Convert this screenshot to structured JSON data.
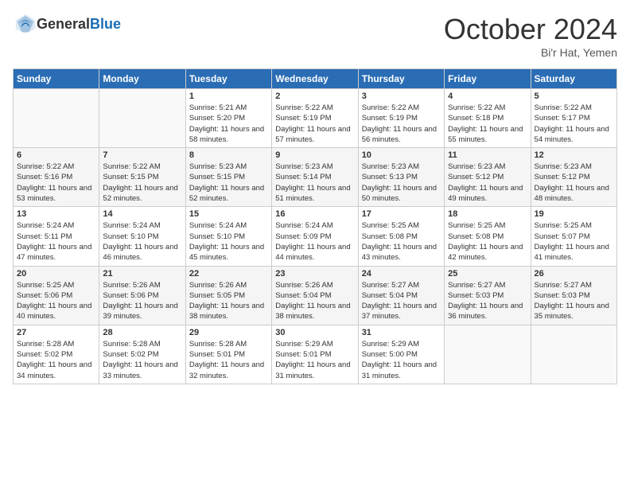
{
  "logo": {
    "general": "General",
    "blue": "Blue"
  },
  "header": {
    "month": "October 2024",
    "location": "Bi'r Hat, Yemen"
  },
  "days_of_week": [
    "Sunday",
    "Monday",
    "Tuesday",
    "Wednesday",
    "Thursday",
    "Friday",
    "Saturday"
  ],
  "weeks": [
    [
      {
        "day": "",
        "sunrise": "",
        "sunset": "",
        "daylight": ""
      },
      {
        "day": "",
        "sunrise": "",
        "sunset": "",
        "daylight": ""
      },
      {
        "day": "1",
        "sunrise": "Sunrise: 5:21 AM",
        "sunset": "Sunset: 5:20 PM",
        "daylight": "Daylight: 11 hours and 58 minutes."
      },
      {
        "day": "2",
        "sunrise": "Sunrise: 5:22 AM",
        "sunset": "Sunset: 5:19 PM",
        "daylight": "Daylight: 11 hours and 57 minutes."
      },
      {
        "day": "3",
        "sunrise": "Sunrise: 5:22 AM",
        "sunset": "Sunset: 5:19 PM",
        "daylight": "Daylight: 11 hours and 56 minutes."
      },
      {
        "day": "4",
        "sunrise": "Sunrise: 5:22 AM",
        "sunset": "Sunset: 5:18 PM",
        "daylight": "Daylight: 11 hours and 55 minutes."
      },
      {
        "day": "5",
        "sunrise": "Sunrise: 5:22 AM",
        "sunset": "Sunset: 5:17 PM",
        "daylight": "Daylight: 11 hours and 54 minutes."
      }
    ],
    [
      {
        "day": "6",
        "sunrise": "Sunrise: 5:22 AM",
        "sunset": "Sunset: 5:16 PM",
        "daylight": "Daylight: 11 hours and 53 minutes."
      },
      {
        "day": "7",
        "sunrise": "Sunrise: 5:22 AM",
        "sunset": "Sunset: 5:15 PM",
        "daylight": "Daylight: 11 hours and 52 minutes."
      },
      {
        "day": "8",
        "sunrise": "Sunrise: 5:23 AM",
        "sunset": "Sunset: 5:15 PM",
        "daylight": "Daylight: 11 hours and 52 minutes."
      },
      {
        "day": "9",
        "sunrise": "Sunrise: 5:23 AM",
        "sunset": "Sunset: 5:14 PM",
        "daylight": "Daylight: 11 hours and 51 minutes."
      },
      {
        "day": "10",
        "sunrise": "Sunrise: 5:23 AM",
        "sunset": "Sunset: 5:13 PM",
        "daylight": "Daylight: 11 hours and 50 minutes."
      },
      {
        "day": "11",
        "sunrise": "Sunrise: 5:23 AM",
        "sunset": "Sunset: 5:12 PM",
        "daylight": "Daylight: 11 hours and 49 minutes."
      },
      {
        "day": "12",
        "sunrise": "Sunrise: 5:23 AM",
        "sunset": "Sunset: 5:12 PM",
        "daylight": "Daylight: 11 hours and 48 minutes."
      }
    ],
    [
      {
        "day": "13",
        "sunrise": "Sunrise: 5:24 AM",
        "sunset": "Sunset: 5:11 PM",
        "daylight": "Daylight: 11 hours and 47 minutes."
      },
      {
        "day": "14",
        "sunrise": "Sunrise: 5:24 AM",
        "sunset": "Sunset: 5:10 PM",
        "daylight": "Daylight: 11 hours and 46 minutes."
      },
      {
        "day": "15",
        "sunrise": "Sunrise: 5:24 AM",
        "sunset": "Sunset: 5:10 PM",
        "daylight": "Daylight: 11 hours and 45 minutes."
      },
      {
        "day": "16",
        "sunrise": "Sunrise: 5:24 AM",
        "sunset": "Sunset: 5:09 PM",
        "daylight": "Daylight: 11 hours and 44 minutes."
      },
      {
        "day": "17",
        "sunrise": "Sunrise: 5:25 AM",
        "sunset": "Sunset: 5:08 PM",
        "daylight": "Daylight: 11 hours and 43 minutes."
      },
      {
        "day": "18",
        "sunrise": "Sunrise: 5:25 AM",
        "sunset": "Sunset: 5:08 PM",
        "daylight": "Daylight: 11 hours and 42 minutes."
      },
      {
        "day": "19",
        "sunrise": "Sunrise: 5:25 AM",
        "sunset": "Sunset: 5:07 PM",
        "daylight": "Daylight: 11 hours and 41 minutes."
      }
    ],
    [
      {
        "day": "20",
        "sunrise": "Sunrise: 5:25 AM",
        "sunset": "Sunset: 5:06 PM",
        "daylight": "Daylight: 11 hours and 40 minutes."
      },
      {
        "day": "21",
        "sunrise": "Sunrise: 5:26 AM",
        "sunset": "Sunset: 5:06 PM",
        "daylight": "Daylight: 11 hours and 39 minutes."
      },
      {
        "day": "22",
        "sunrise": "Sunrise: 5:26 AM",
        "sunset": "Sunset: 5:05 PM",
        "daylight": "Daylight: 11 hours and 38 minutes."
      },
      {
        "day": "23",
        "sunrise": "Sunrise: 5:26 AM",
        "sunset": "Sunset: 5:04 PM",
        "daylight": "Daylight: 11 hours and 38 minutes."
      },
      {
        "day": "24",
        "sunrise": "Sunrise: 5:27 AM",
        "sunset": "Sunset: 5:04 PM",
        "daylight": "Daylight: 11 hours and 37 minutes."
      },
      {
        "day": "25",
        "sunrise": "Sunrise: 5:27 AM",
        "sunset": "Sunset: 5:03 PM",
        "daylight": "Daylight: 11 hours and 36 minutes."
      },
      {
        "day": "26",
        "sunrise": "Sunrise: 5:27 AM",
        "sunset": "Sunset: 5:03 PM",
        "daylight": "Daylight: 11 hours and 35 minutes."
      }
    ],
    [
      {
        "day": "27",
        "sunrise": "Sunrise: 5:28 AM",
        "sunset": "Sunset: 5:02 PM",
        "daylight": "Daylight: 11 hours and 34 minutes."
      },
      {
        "day": "28",
        "sunrise": "Sunrise: 5:28 AM",
        "sunset": "Sunset: 5:02 PM",
        "daylight": "Daylight: 11 hours and 33 minutes."
      },
      {
        "day": "29",
        "sunrise": "Sunrise: 5:28 AM",
        "sunset": "Sunset: 5:01 PM",
        "daylight": "Daylight: 11 hours and 32 minutes."
      },
      {
        "day": "30",
        "sunrise": "Sunrise: 5:29 AM",
        "sunset": "Sunset: 5:01 PM",
        "daylight": "Daylight: 11 hours and 31 minutes."
      },
      {
        "day": "31",
        "sunrise": "Sunrise: 5:29 AM",
        "sunset": "Sunset: 5:00 PM",
        "daylight": "Daylight: 11 hours and 31 minutes."
      },
      {
        "day": "",
        "sunrise": "",
        "sunset": "",
        "daylight": ""
      },
      {
        "day": "",
        "sunrise": "",
        "sunset": "",
        "daylight": ""
      }
    ]
  ]
}
